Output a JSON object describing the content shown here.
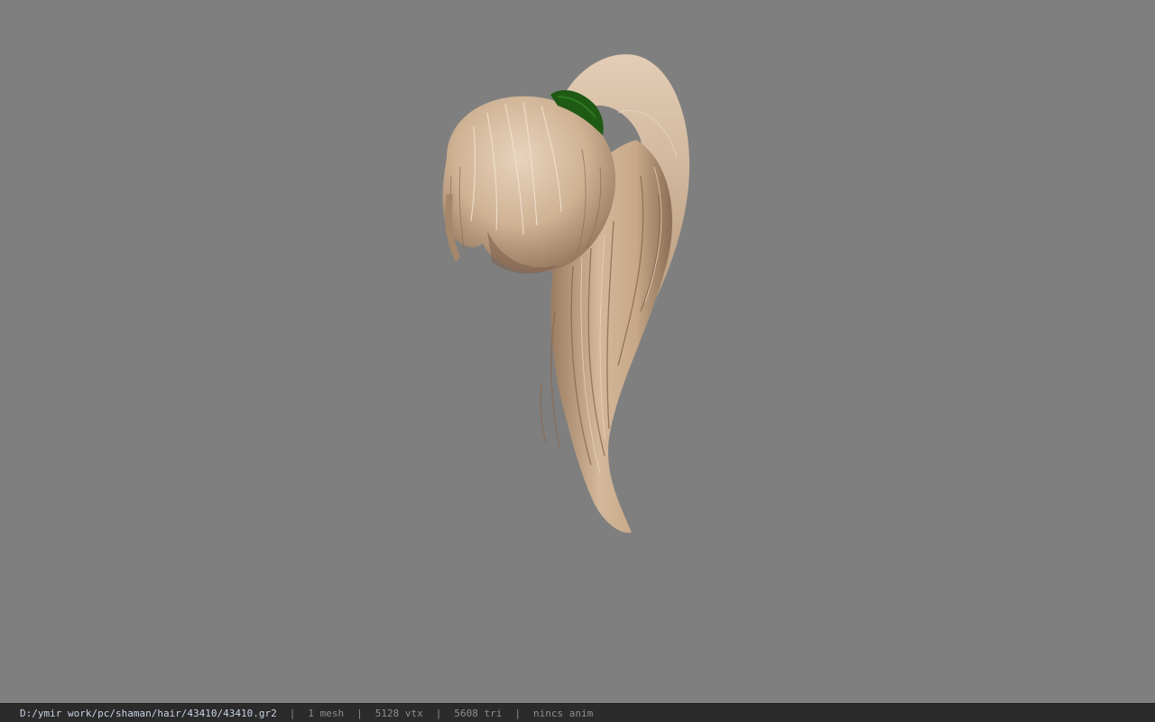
{
  "viewport": {
    "background_color": "#7f7f7f",
    "model": {
      "icon": "hair-ponytail-model",
      "hair_color": "#c9a98a",
      "tie_color": "#1f5a14"
    }
  },
  "statusbar": {
    "file_path": "D:/ymir work/pc/shaman/hair/43410/43410.gr2",
    "separator": "|",
    "mesh_count": "1 mesh",
    "vertex_count": "5128 vtx",
    "triangle_count": "5608 tri",
    "anim_status": "nincs anim"
  }
}
